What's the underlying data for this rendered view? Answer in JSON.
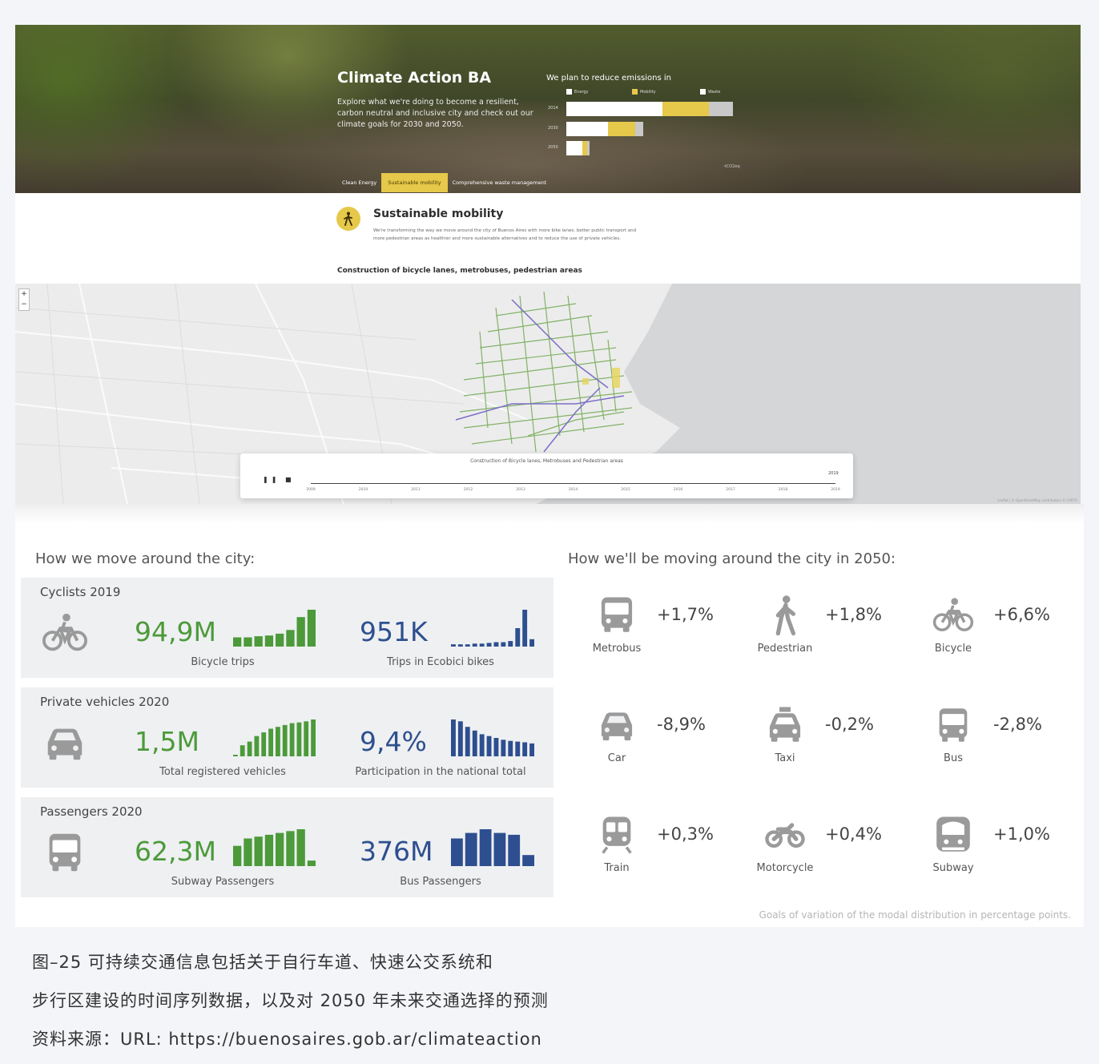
{
  "hero": {
    "title": "Climate Action BA",
    "description": "Explore what we're doing to become a resilient, carbon neutral and inclusive city and check out our climate goals for 2030 and 2050.",
    "plan_title": "We plan to reduce emissions in",
    "legend": [
      "Energy",
      "Mobility",
      "Waste"
    ],
    "rows": [
      "2014",
      "2030",
      "2050"
    ],
    "footer": "-tCO2eq",
    "tabs": [
      "Clean Energy",
      "Sustainable mobility",
      "Comprehensive waste management"
    ],
    "colors": {
      "energy": "#ffffff",
      "mobility": "#e6c84a",
      "waste": "#c8c8c8",
      "accent": "#e6c84a"
    }
  },
  "mobility": {
    "icon": "pedestrian-icon",
    "title": "Sustainable mobility",
    "description": "We're transforming the way we move around the city of Buenos Aires with more bike lanes, better public transport and more pedestrian areas as healthier and more sustainable alternatives and to reduce the use of private vehicles.",
    "construction_title": "Construction of bicycle lanes, metrobuses, pedestrian areas"
  },
  "map": {
    "zoom_in": "+",
    "zoom_out": "−",
    "timeline_title": "Construction of Bicycle lanes, Metrobuses and Pedestrian areas",
    "controls": "❚❚ ■",
    "current_year": "2019",
    "ticks": [
      "2009",
      "2010",
      "2011",
      "2012",
      "2013",
      "2014",
      "2015",
      "2016",
      "2017",
      "2018",
      "2019"
    ],
    "attribution": "Leaflet | © OpenStreetMap contributors © CARTO",
    "colors": {
      "bike_lanes": "#6fa84f",
      "metrobuses": "#7b6fc8",
      "pedestrian": "#e6d45a",
      "water": "#cfd1d3",
      "land": "#ececec"
    }
  },
  "current": {
    "heading": "How we move around the city:",
    "panels": [
      {
        "title": "Cyclists 2019",
        "icon": "bicycle-icon",
        "left": {
          "value": "94,9M",
          "label": "Bicycle trips",
          "bars": [
            0.25,
            0.25,
            0.28,
            0.3,
            0.35,
            0.45,
            0.8,
            1.0
          ]
        },
        "right": {
          "value": "951K",
          "label": "Trips in Ecobici bikes",
          "bars": [
            0.06,
            0.06,
            0.06,
            0.08,
            0.08,
            0.1,
            0.12,
            0.12,
            0.15,
            0.5,
            1.0,
            0.2
          ]
        }
      },
      {
        "title": "Private vehicles 2020",
        "icon": "car-icon",
        "left": {
          "value": "1,5M",
          "label": "Total registered vehicles",
          "bars": [
            0.04,
            0.3,
            0.4,
            0.55,
            0.65,
            0.75,
            0.8,
            0.85,
            0.9,
            0.92,
            0.95,
            1.0
          ]
        },
        "right": {
          "value": "9,4%",
          "label": "Participation in the national total",
          "bars": [
            1.0,
            0.95,
            0.8,
            0.7,
            0.6,
            0.55,
            0.5,
            0.45,
            0.42,
            0.4,
            0.38,
            0.35
          ]
        }
      },
      {
        "title": "Passengers 2020",
        "icon": "bus-icon",
        "left": {
          "value": "62,3M",
          "label": "Subway Passengers",
          "bars": [
            0.55,
            0.75,
            0.8,
            0.85,
            0.9,
            0.95,
            1.0,
            0.15
          ]
        },
        "right": {
          "value": "376M",
          "label": "Bus Passengers",
          "bars": [
            0.75,
            0.9,
            1.0,
            0.9,
            0.85,
            0.3
          ]
        }
      }
    ]
  },
  "future": {
    "heading": "How we'll be moving around the city in 2050:",
    "modes": [
      {
        "label": "Metrobus",
        "pct": "+1,7%",
        "icon": "metrobus-icon"
      },
      {
        "label": "Pedestrian",
        "pct": "+1,8%",
        "icon": "pedestrian-icon"
      },
      {
        "label": "Bicycle",
        "pct": "+6,6%",
        "icon": "bicycle-icon"
      },
      {
        "label": "Car",
        "pct": "-8,9%",
        "icon": "car-icon"
      },
      {
        "label": "Taxi",
        "pct": "-0,2%",
        "icon": "taxi-icon"
      },
      {
        "label": "Bus",
        "pct": "-2,8%",
        "icon": "bus-icon"
      },
      {
        "label": "Train",
        "pct": "+0,3%",
        "icon": "train-icon"
      },
      {
        "label": "Motorcycle",
        "pct": "+0,4%",
        "icon": "motorcycle-icon"
      },
      {
        "label": "Subway",
        "pct": "+1,0%",
        "icon": "subway-icon"
      }
    ],
    "footnote": "Goals of variation of the modal distribution in percentage points."
  },
  "caption": {
    "line1": "图–25 可持续交通信息包括关于自行车道、快速公交系统和",
    "line2": "步行区建设的时间序列数据，以及对 2050 年未来交通选择的预测",
    "line3": "资料来源：URL: https://buenosaires.gob.ar/climateaction"
  },
  "colors": {
    "green": "#4c9a3a",
    "blue": "#2e4f8f",
    "icon_gray": "#999999",
    "panel_bg": "#eef0f2"
  }
}
